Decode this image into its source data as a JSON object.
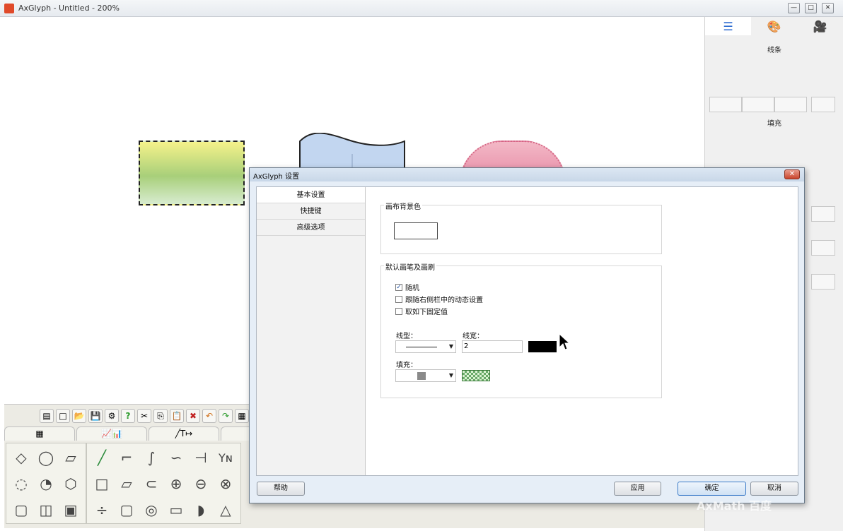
{
  "window": {
    "title": "AxGlyph - Untitled - 200%",
    "min_glyph": "—",
    "max_glyph": "□",
    "close_glyph": "✕"
  },
  "right_panel": {
    "tabs": [
      {
        "icon": "layers-icon",
        "glyph": "☰"
      },
      {
        "icon": "palette-icon",
        "glyph": "🎨"
      },
      {
        "icon": "camera-icon",
        "glyph": "🎥"
      }
    ],
    "line_label": "线条",
    "fill_label": "填充"
  },
  "toolbar": {
    "buttons": [
      "▤",
      "□",
      "📂",
      "💾",
      "⚙",
      "?",
      "✂",
      "⎘",
      "📋",
      "✖",
      "↶",
      "↷",
      "▦"
    ]
  },
  "shape_categories": [
    {
      "glyph": "▦"
    },
    {
      "glyph": "📈📊"
    },
    {
      "glyph": "╱T↦"
    },
    {
      "glyph": "△"
    }
  ],
  "shape_groups": [
    [
      "◇",
      "◯",
      "▱",
      "◌",
      "◔",
      "⬡",
      "▢",
      "◫",
      "▣"
    ],
    [
      "╱",
      "⌐",
      "∫",
      "∽",
      "⊣",
      "Yɴ",
      "□",
      "▱",
      "⊂"
    ],
    [
      "⊕",
      "⊖",
      "⊗",
      "÷",
      "▢",
      "◎",
      "▭",
      "◗",
      "△"
    ]
  ],
  "shape_strip": [
    "💬",
    "↱",
    "⇨",
    "↻",
    "⤴",
    "⏢",
    "⬠",
    "⬚",
    "⏳",
    "⏶",
    "◎",
    "╱",
    "☰",
    "⌊",
    "▤"
  ],
  "dialog": {
    "title": "AxGlyph 设置",
    "close_glyph": "✕",
    "nav": [
      "基本设置",
      "快捷键",
      "高级选项"
    ],
    "canvas_bg_group": "画布背景色",
    "pen_group": "默认画笔及画刷",
    "options": [
      {
        "label": "随机",
        "checked": true
      },
      {
        "label": "跟随右侧栏中的动态设置",
        "checked": false
      },
      {
        "label": "取如下固定值",
        "checked": false
      }
    ],
    "line_type_label": "线型：",
    "line_width_label": "线宽：",
    "line_width_value": "2",
    "fill_label": "填充：",
    "line_color": "#000000",
    "buttons": {
      "help": "帮助",
      "apply": "应用",
      "ok": "确定",
      "cancel": "取消"
    }
  },
  "watermark": "AxMath 百度"
}
